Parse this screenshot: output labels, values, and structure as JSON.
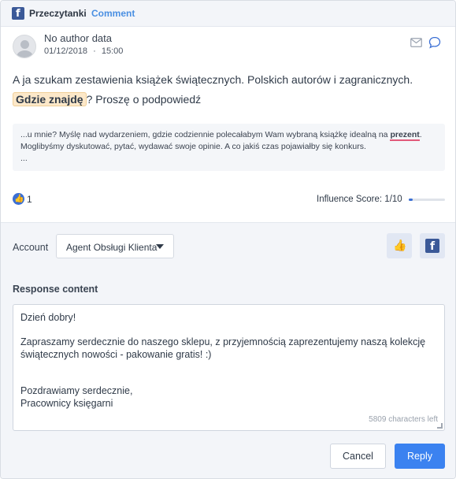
{
  "header": {
    "source_name": "Przeczytanki",
    "source_type": "Comment",
    "source_icon": "facebook-icon"
  },
  "mention": {
    "author": "No author data",
    "date": "01/12/2018",
    "separator": "·",
    "time": "15:00",
    "post_before": "A ja szukam zestawienia książek świątecznych. Polskich autorów i zagranicznych. ",
    "post_highlight": "Gdzie znajdę",
    "post_after": "? Proszę o podpowiedź",
    "quote_before": "...u mnie? Myślę nad wydarzeniem, gdzie codziennie polecałabym Wam wybraną książkę idealną na ",
    "quote_highlight": "prezent",
    "quote_after": ". Moglibyśmy dyskutować, pytać, wydawać swoje opinie. A co jakiś czas pojawiałby się konkurs.",
    "quote_ellipsis": "...",
    "like_count": "1",
    "influence_label": "Influence Score: 1/10",
    "influence_value": 0.1
  },
  "response": {
    "account_label": "Account",
    "account_value": "Agent Obsługi Klienta",
    "content_label": "Response content",
    "content": "Dzień dobry!\n\nZapraszamy serdecznie do naszego sklepu, z przyjemnością zaprezentujemy naszą kolekcję świątecznych nowości - pakowanie gratis! :)\n\n\nPozdrawiamy serdecznie,\nPracownicy księgarni",
    "chars_left": "5809 characters left",
    "cancel_label": "Cancel",
    "reply_label": "Reply"
  },
  "colors": {
    "accent": "#3b82f0",
    "facebook": "#3b5998",
    "highlight": "#fce8c9",
    "quote_underline": "#e25a7a"
  }
}
